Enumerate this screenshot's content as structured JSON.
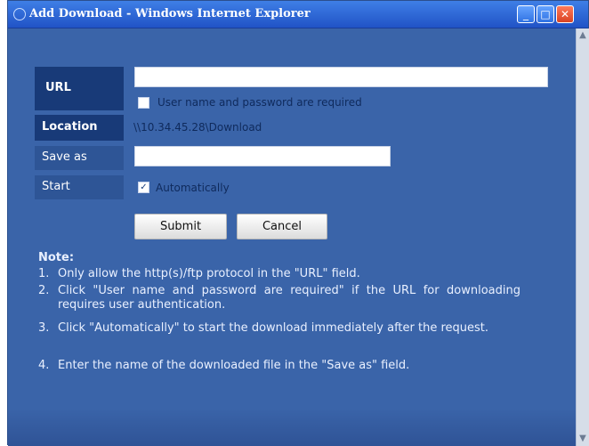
{
  "window": {
    "title": "Add Download - Windows Internet Explorer",
    "min_label": "_",
    "max_label": "□",
    "close_label": "✕"
  },
  "form": {
    "url_label": "URL",
    "url_value": "",
    "auth_checkbox_label": "User name and password are required",
    "auth_checked": false,
    "location_label": "Location",
    "location_value": "\\\\10.34.45.28\\Download",
    "save_as_label": "Save as",
    "save_as_value": "",
    "start_label": "Start",
    "auto_checkbox_label": "Automatically",
    "auto_checked": true,
    "check_mark": "✓",
    "submit_label": "Submit",
    "cancel_label": "Cancel"
  },
  "note": {
    "title": "Note:",
    "items": [
      {
        "num": "1.",
        "text": "Only allow the http(s)/ftp protocol in the \"URL\" field."
      },
      {
        "num": "2.",
        "text": "Click \"User name and password are required\" if the URL for downloading requires user authentication."
      },
      {
        "num": "3.",
        "text": "Click \"Automatically\" to start the download immediately after the request."
      },
      {
        "num": "4.",
        "text": "Enter the name of the downloaded file in the \"Save as\" field."
      }
    ]
  },
  "scrollbar": {
    "up_arrow": "▲",
    "down_arrow": "▼"
  },
  "colors": {
    "window_bg": "#3a64a9",
    "label_bg": "#183a78",
    "titlebar": "#2153c6"
  }
}
